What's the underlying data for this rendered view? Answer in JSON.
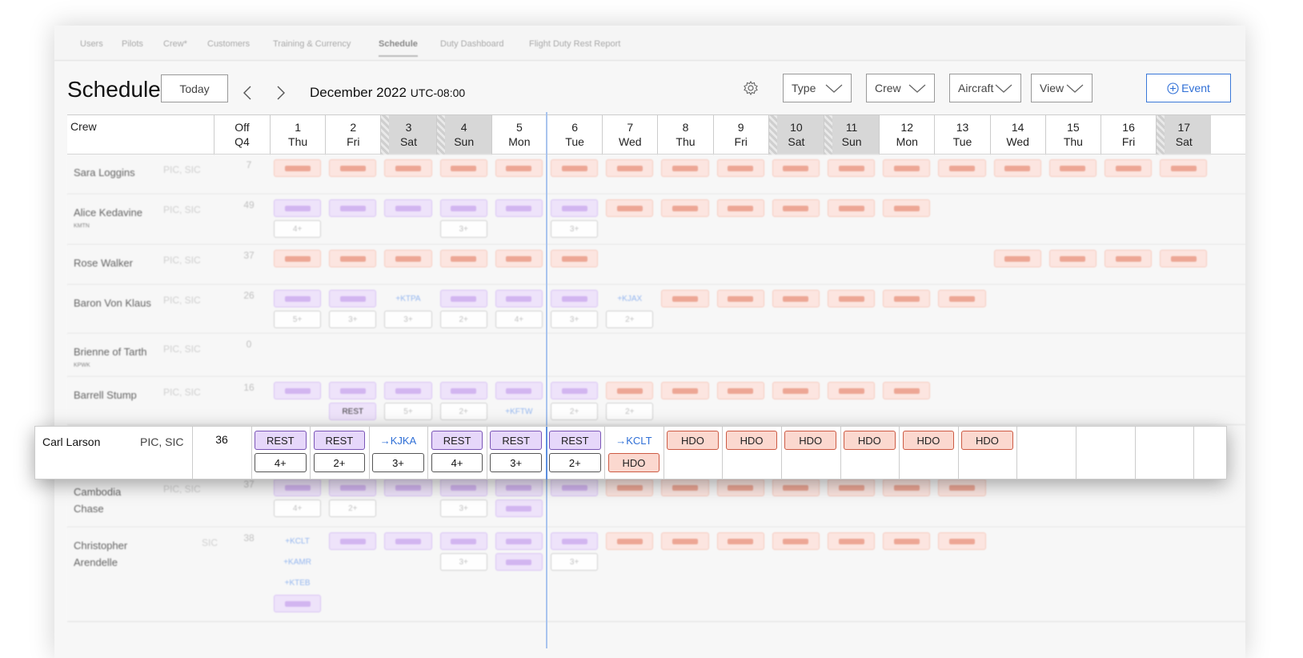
{
  "nav": {
    "tabs": [
      "Users",
      "Pilots",
      "Crew*",
      "Customers",
      "Training & Currency",
      "Schedule",
      "Duty Dashboard",
      "Flight Duty Rest Report"
    ],
    "active_tab": "Schedule"
  },
  "header": {
    "title": "Schedule",
    "today_label": "Today",
    "month_label": "December 2022",
    "timezone": "UTC-08:00",
    "filters": [
      "Type",
      "Crew",
      "Aircraft",
      "View"
    ],
    "event_label": "Event",
    "icons": [
      "chevron-left-icon",
      "chevron-right-icon",
      "settings-icon",
      "chevron-down-icon",
      "plus-circle-icon"
    ]
  },
  "grid": {
    "crew_header": "Crew",
    "off_header": [
      "Off",
      "Q4"
    ],
    "days": [
      {
        "num": "1",
        "dow": "Thu",
        "weekend": false
      },
      {
        "num": "2",
        "dow": "Fri",
        "weekend": false
      },
      {
        "num": "3",
        "dow": "Sat",
        "weekend": true
      },
      {
        "num": "4",
        "dow": "Sun",
        "weekend": true
      },
      {
        "num": "5",
        "dow": "Mon",
        "weekend": false
      },
      {
        "num": "6",
        "dow": "Tue",
        "weekend": false
      },
      {
        "num": "7",
        "dow": "Wed",
        "weekend": false
      },
      {
        "num": "8",
        "dow": "Thu",
        "weekend": false
      },
      {
        "num": "9",
        "dow": "Fri",
        "weekend": false
      },
      {
        "num": "10",
        "dow": "Sat",
        "weekend": true
      },
      {
        "num": "11",
        "dow": "Sun",
        "weekend": true
      },
      {
        "num": "12",
        "dow": "Mon",
        "weekend": false
      },
      {
        "num": "13",
        "dow": "Tue",
        "weekend": false
      },
      {
        "num": "14",
        "dow": "Wed",
        "weekend": false
      },
      {
        "num": "15",
        "dow": "Thu",
        "weekend": false
      },
      {
        "num": "16",
        "dow": "Fri",
        "weekend": false
      },
      {
        "num": "17",
        "dow": "Sat",
        "weekend": true
      }
    ],
    "rows": [
      {
        "name": "Sara Loggins",
        "role": "PIC, SIC",
        "off": "7",
        "sub": ""
      },
      {
        "name": "Alice Kedavine",
        "role": "PIC, SIC",
        "off": "49",
        "sub": "KMTN"
      },
      {
        "name": "Rose Walker",
        "role": "PIC, SIC",
        "off": "37",
        "sub": ""
      },
      {
        "name": "Baron Von Klaus",
        "role": "PIC, SIC",
        "off": "26",
        "sub": ""
      },
      {
        "name": "Brienne of Tarth",
        "role": "PIC, SIC",
        "off": "0",
        "sub": "KPWK"
      },
      {
        "name": "Barrell Stump",
        "role": "PIC, SIC",
        "off": "16",
        "sub": ""
      },
      {
        "name": "Cambodia Chase",
        "role": "PIC, SIC",
        "off": "37",
        "sub": ""
      },
      {
        "name": "Christopher Arendelle",
        "role": "SIC",
        "off": "38",
        "sub": ""
      }
    ],
    "blur_labels": {
      "rest": "REST",
      "k_ktpa": "+KTPA",
      "k_kjax": "+KJAX",
      "k_kftw": "+KFTW",
      "k_kclt": "+KCLT",
      "k_kamr": "+KAMR",
      "k_kteb": "+KTEB",
      "c2": "2+",
      "c3": "3+",
      "c4": "4+",
      "c5": "5+"
    }
  },
  "focused_row": {
    "name": "Carl Larson",
    "role": "PIC, SIC",
    "off": "36",
    "top_chips": [
      "REST",
      "REST",
      "→KJKA",
      "REST",
      "REST",
      "REST",
      "→KCLT",
      "HDO",
      "HDO",
      "HDO",
      "HDO",
      "HDO",
      "HDO"
    ],
    "bottom_chips": [
      "4+",
      "2+",
      "3+",
      "4+",
      "3+",
      "2+",
      "HDO"
    ]
  }
}
